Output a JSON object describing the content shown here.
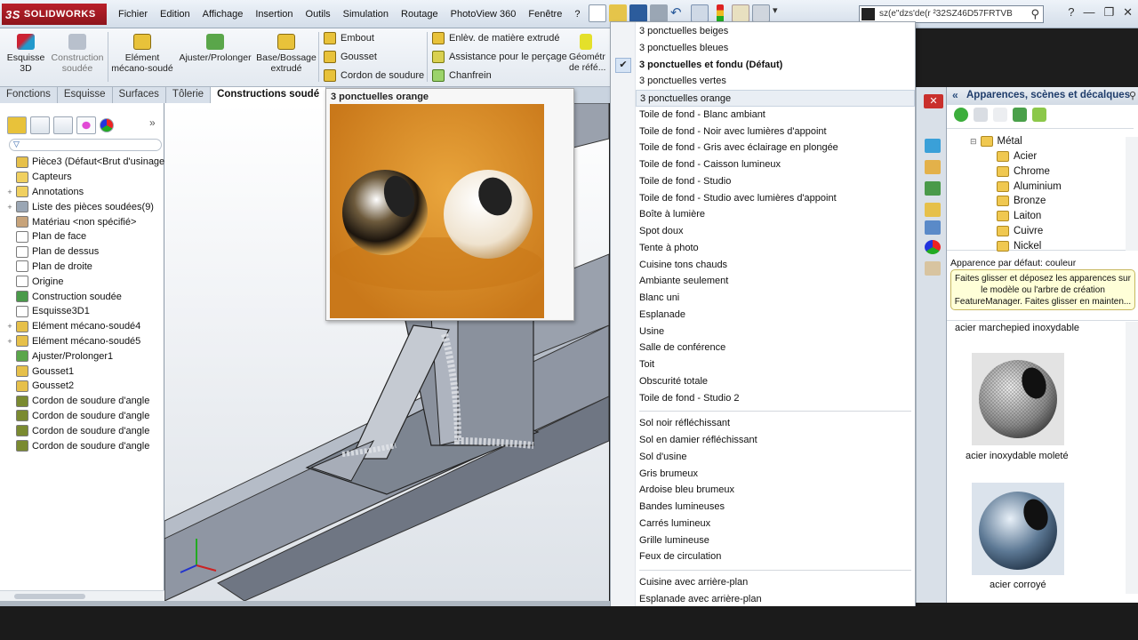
{
  "app": {
    "logo_text": "SOLIDWORKS",
    "logo_prefix": "3S"
  },
  "menu": [
    "Fichier",
    "Edition",
    "Affichage",
    "Insertion",
    "Outils",
    "Simulation",
    "Routage",
    "PhotoView 360",
    "Fenêtre",
    "?"
  ],
  "search": {
    "value": "sz(e\"dzs'de(r ²32SZ46D57FRTVB"
  },
  "commands": {
    "large": [
      {
        "label": "Esquisse\n3D"
      },
      {
        "label": "Construction\nsoudée"
      },
      {
        "label": "Elément\nmécano-soudé"
      },
      {
        "label": "Ajuster/Prolonger"
      },
      {
        "label": "Base/Bossage\nextrudé"
      }
    ],
    "small_col1": [
      "Embout",
      "Gousset",
      "Cordon de soudure"
    ],
    "small_col2": [
      "Enlèv. de matière extrudé",
      "Assistance pour le perçage",
      "Chanfrein"
    ],
    "ref_geometry": "Géométr\nde réfé..."
  },
  "tabs": [
    {
      "label": "Fonctions",
      "active": false
    },
    {
      "label": "Esquisse",
      "active": false
    },
    {
      "label": "Surfaces",
      "active": false
    },
    {
      "label": "Tôlerie",
      "active": false
    },
    {
      "label": "Constructions soudé",
      "active": true
    }
  ],
  "feature_tree": [
    {
      "label": "Pièce3  (Défaut<Brut d'usinage",
      "expand": "",
      "icon": "part-icon"
    },
    {
      "label": "Capteurs",
      "expand": "",
      "icon": "folder-icon"
    },
    {
      "label": "Annotations",
      "expand": "+",
      "icon": "annotation-icon"
    },
    {
      "label": "Liste des pièces soudées(9)",
      "expand": "+",
      "icon": "cutlist-icon"
    },
    {
      "label": "Matériau <non spécifié>",
      "expand": "",
      "icon": "material-icon"
    },
    {
      "label": "Plan de face",
      "expand": "",
      "icon": "plane-icon"
    },
    {
      "label": "Plan de dessus",
      "expand": "",
      "icon": "plane-icon"
    },
    {
      "label": "Plan de droite",
      "expand": "",
      "icon": "plane-icon"
    },
    {
      "label": "Origine",
      "expand": "",
      "icon": "origin-icon"
    },
    {
      "label": "Construction soudée",
      "expand": "",
      "icon": "weldment-icon"
    },
    {
      "label": "Esquisse3D1",
      "expand": "",
      "icon": "sketch-icon"
    },
    {
      "label": "Elément mécano-soudé4",
      "expand": "+",
      "icon": "structural-member-icon"
    },
    {
      "label": "Elément mécano-soudé5",
      "expand": "+",
      "icon": "structural-member-icon"
    },
    {
      "label": "Ajuster/Prolonger1",
      "expand": "",
      "icon": "trim-icon"
    },
    {
      "label": "Gousset1",
      "expand": "",
      "icon": "gusset-icon"
    },
    {
      "label": "Gousset2",
      "expand": "",
      "icon": "gusset-icon"
    },
    {
      "label": "Cordon de soudure d'angle",
      "expand": "",
      "icon": "fillet-weld-icon"
    },
    {
      "label": "Cordon de soudure d'angle",
      "expand": "",
      "icon": "fillet-weld-icon"
    },
    {
      "label": "Cordon de soudure d'angle",
      "expand": "",
      "icon": "fillet-weld-icon"
    },
    {
      "label": "Cordon de soudure d'angle",
      "expand": "",
      "icon": "fillet-weld-icon"
    }
  ],
  "preview": {
    "title": "3 ponctuelles orange"
  },
  "scenes": {
    "group1": [
      {
        "label": "3 ponctuelles beiges"
      },
      {
        "label": "3 ponctuelles bleues"
      },
      {
        "label": "3 ponctuelles et fondu  (Défaut)",
        "checked": true,
        "bold": true
      },
      {
        "label": "3 ponctuelles vertes"
      },
      {
        "label": "3 ponctuelles orange",
        "hover": true
      },
      {
        "label": "Toile de fond - Blanc ambiant"
      },
      {
        "label": "Toile de fond - Noir avec lumières d'appoint"
      },
      {
        "label": "Toile de fond - Gris avec éclairage en plongée"
      },
      {
        "label": "Toile de fond - Caisson lumineux"
      },
      {
        "label": "Toile de fond - Studio"
      },
      {
        "label": "Toile de fond - Studio avec lumières d'appoint"
      },
      {
        "label": "Boîte à lumière"
      },
      {
        "label": "Spot doux"
      },
      {
        "label": "Tente à photo"
      },
      {
        "label": "Cuisine tons chauds"
      },
      {
        "label": "Ambiante seulement"
      },
      {
        "label": "Blanc uni"
      },
      {
        "label": "Esplanade"
      },
      {
        "label": "Usine"
      },
      {
        "label": "Salle de conférence"
      },
      {
        "label": "Toit"
      },
      {
        "label": "Obscurité totale"
      },
      {
        "label": "Toile de fond - Studio 2"
      }
    ],
    "group2": [
      {
        "label": "Sol noir réfléchissant"
      },
      {
        "label": "Sol en damier réfléchissant"
      },
      {
        "label": "Sol d'usine"
      },
      {
        "label": "Gris brumeux"
      },
      {
        "label": "Ardoise bleu brumeux"
      },
      {
        "label": "Bandes lumineuses"
      },
      {
        "label": "Carrés lumineux"
      },
      {
        "label": "Grille lumineuse"
      },
      {
        "label": "Feux de circulation"
      }
    ],
    "group3": [
      {
        "label": "Cuisine avec arrière-plan"
      },
      {
        "label": "Esplanade avec arrière-plan"
      }
    ]
  },
  "appearances": {
    "header": "Apparences, scènes et décalques",
    "tree_root": "Métal",
    "tree_items": [
      "Acier",
      "Chrome",
      "Aluminium",
      "Bronze",
      "Laiton",
      "Cuivre",
      "Nickel"
    ],
    "status": "Apparence par défaut: couleur",
    "tip": "Faites glisser et déposez les apparences sur le modèle ou l'arbre de création FeatureManager. Faites glisser en mainten...",
    "gallery": [
      {
        "label": "acier marchepied inoxydable"
      },
      {
        "label": "acier inoxydable moleté"
      },
      {
        "label": "acier corroyé"
      }
    ]
  },
  "colors": {
    "brand_red": "#b9202a",
    "accent_blue": "#1f3d6b",
    "preview_orange": "#d98a22"
  }
}
